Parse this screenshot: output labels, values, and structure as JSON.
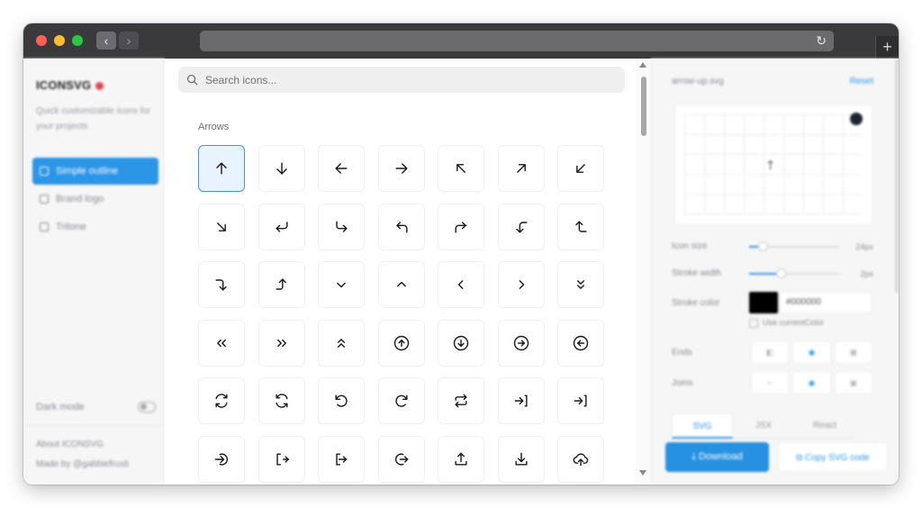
{
  "browser": {
    "back_glyph": "‹",
    "forward_glyph": "›",
    "reload_glyph": "↻",
    "newtab_glyph": "+"
  },
  "sidebar": {
    "brand": "ICONSVG",
    "tagline": "Quick customizable icons for your projects",
    "items": [
      {
        "label": "Simple outline",
        "active": true
      },
      {
        "label": "Brand logo",
        "active": false
      },
      {
        "label": "Tritone",
        "active": false
      }
    ],
    "dark_mode_label": "Dark mode",
    "about_label": "About ICONSVG",
    "made_by_label": "Made by @gabbiefrusti"
  },
  "search": {
    "placeholder": "Search icons..."
  },
  "section": {
    "title": "Arrows"
  },
  "icons": [
    "arrow-up",
    "arrow-down",
    "arrow-left",
    "arrow-right",
    "arrow-up-left",
    "arrow-up-right",
    "arrow-down-left",
    "arrow-down-right",
    "return-down-left",
    "corner-down-right",
    "corner-up-left",
    "corner-up-right",
    "corner-left-down",
    "corner-left-up",
    "corner-right-down",
    "corner-right-up",
    "chevron-down",
    "chevron-up",
    "chevron-left",
    "chevron-right",
    "chevrons-down",
    "chevrons-left",
    "chevrons-right",
    "chevrons-up",
    "arrow-up-circle",
    "arrow-down-circle",
    "arrow-right-circle",
    "arrow-left-circle",
    "refresh-ccw",
    "refresh-cw",
    "rotate-ccw",
    "rotate-cw",
    "repeat",
    "arrow-right-to-line",
    "arrow-right-to-line",
    "log-in-circle",
    "log-out",
    "log-in",
    "arrow-left-circle-out",
    "upload",
    "download",
    "cloud-upload"
  ],
  "panel": {
    "file_name": "arrow-up.svg",
    "reset_label": "Reset",
    "icon_size_label": "Icon size",
    "icon_size_value": "24px",
    "icon_size_level": 0.15,
    "stroke_width_label": "Stroke width",
    "stroke_width_value": "2px",
    "stroke_width_level": 0.35,
    "stroke_color_label": "Stroke color",
    "stroke_color_value": "#000000",
    "current_color_label": "Use currentColor",
    "ends_label": "Ends",
    "joins_label": "Joins",
    "tabs": [
      "SVG",
      "JSX",
      "React"
    ],
    "download_label": "⤓ Download",
    "copy_label": "⧉ Copy SVG code"
  },
  "colors": {
    "accent": "#2b95e6",
    "selected_bg": "#e8f3fd",
    "brand_dot": "#e6474d"
  }
}
